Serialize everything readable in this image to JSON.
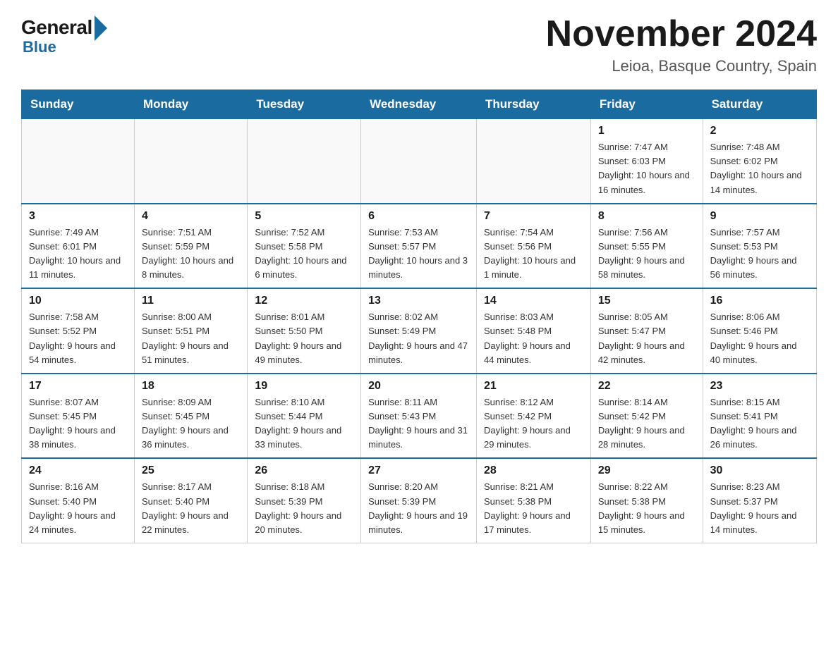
{
  "logo": {
    "general": "General",
    "blue": "Blue"
  },
  "title": "November 2024",
  "subtitle": "Leioa, Basque Country, Spain",
  "headers": [
    "Sunday",
    "Monday",
    "Tuesday",
    "Wednesday",
    "Thursday",
    "Friday",
    "Saturday"
  ],
  "weeks": [
    [
      {
        "day": "",
        "info": ""
      },
      {
        "day": "",
        "info": ""
      },
      {
        "day": "",
        "info": ""
      },
      {
        "day": "",
        "info": ""
      },
      {
        "day": "",
        "info": ""
      },
      {
        "day": "1",
        "info": "Sunrise: 7:47 AM\nSunset: 6:03 PM\nDaylight: 10 hours and 16 minutes."
      },
      {
        "day": "2",
        "info": "Sunrise: 7:48 AM\nSunset: 6:02 PM\nDaylight: 10 hours and 14 minutes."
      }
    ],
    [
      {
        "day": "3",
        "info": "Sunrise: 7:49 AM\nSunset: 6:01 PM\nDaylight: 10 hours and 11 minutes."
      },
      {
        "day": "4",
        "info": "Sunrise: 7:51 AM\nSunset: 5:59 PM\nDaylight: 10 hours and 8 minutes."
      },
      {
        "day": "5",
        "info": "Sunrise: 7:52 AM\nSunset: 5:58 PM\nDaylight: 10 hours and 6 minutes."
      },
      {
        "day": "6",
        "info": "Sunrise: 7:53 AM\nSunset: 5:57 PM\nDaylight: 10 hours and 3 minutes."
      },
      {
        "day": "7",
        "info": "Sunrise: 7:54 AM\nSunset: 5:56 PM\nDaylight: 10 hours and 1 minute."
      },
      {
        "day": "8",
        "info": "Sunrise: 7:56 AM\nSunset: 5:55 PM\nDaylight: 9 hours and 58 minutes."
      },
      {
        "day": "9",
        "info": "Sunrise: 7:57 AM\nSunset: 5:53 PM\nDaylight: 9 hours and 56 minutes."
      }
    ],
    [
      {
        "day": "10",
        "info": "Sunrise: 7:58 AM\nSunset: 5:52 PM\nDaylight: 9 hours and 54 minutes."
      },
      {
        "day": "11",
        "info": "Sunrise: 8:00 AM\nSunset: 5:51 PM\nDaylight: 9 hours and 51 minutes."
      },
      {
        "day": "12",
        "info": "Sunrise: 8:01 AM\nSunset: 5:50 PM\nDaylight: 9 hours and 49 minutes."
      },
      {
        "day": "13",
        "info": "Sunrise: 8:02 AM\nSunset: 5:49 PM\nDaylight: 9 hours and 47 minutes."
      },
      {
        "day": "14",
        "info": "Sunrise: 8:03 AM\nSunset: 5:48 PM\nDaylight: 9 hours and 44 minutes."
      },
      {
        "day": "15",
        "info": "Sunrise: 8:05 AM\nSunset: 5:47 PM\nDaylight: 9 hours and 42 minutes."
      },
      {
        "day": "16",
        "info": "Sunrise: 8:06 AM\nSunset: 5:46 PM\nDaylight: 9 hours and 40 minutes."
      }
    ],
    [
      {
        "day": "17",
        "info": "Sunrise: 8:07 AM\nSunset: 5:45 PM\nDaylight: 9 hours and 38 minutes."
      },
      {
        "day": "18",
        "info": "Sunrise: 8:09 AM\nSunset: 5:45 PM\nDaylight: 9 hours and 36 minutes."
      },
      {
        "day": "19",
        "info": "Sunrise: 8:10 AM\nSunset: 5:44 PM\nDaylight: 9 hours and 33 minutes."
      },
      {
        "day": "20",
        "info": "Sunrise: 8:11 AM\nSunset: 5:43 PM\nDaylight: 9 hours and 31 minutes."
      },
      {
        "day": "21",
        "info": "Sunrise: 8:12 AM\nSunset: 5:42 PM\nDaylight: 9 hours and 29 minutes."
      },
      {
        "day": "22",
        "info": "Sunrise: 8:14 AM\nSunset: 5:42 PM\nDaylight: 9 hours and 28 minutes."
      },
      {
        "day": "23",
        "info": "Sunrise: 8:15 AM\nSunset: 5:41 PM\nDaylight: 9 hours and 26 minutes."
      }
    ],
    [
      {
        "day": "24",
        "info": "Sunrise: 8:16 AM\nSunset: 5:40 PM\nDaylight: 9 hours and 24 minutes."
      },
      {
        "day": "25",
        "info": "Sunrise: 8:17 AM\nSunset: 5:40 PM\nDaylight: 9 hours and 22 minutes."
      },
      {
        "day": "26",
        "info": "Sunrise: 8:18 AM\nSunset: 5:39 PM\nDaylight: 9 hours and 20 minutes."
      },
      {
        "day": "27",
        "info": "Sunrise: 8:20 AM\nSunset: 5:39 PM\nDaylight: 9 hours and 19 minutes."
      },
      {
        "day": "28",
        "info": "Sunrise: 8:21 AM\nSunset: 5:38 PM\nDaylight: 9 hours and 17 minutes."
      },
      {
        "day": "29",
        "info": "Sunrise: 8:22 AM\nSunset: 5:38 PM\nDaylight: 9 hours and 15 minutes."
      },
      {
        "day": "30",
        "info": "Sunrise: 8:23 AM\nSunset: 5:37 PM\nDaylight: 9 hours and 14 minutes."
      }
    ]
  ],
  "colors": {
    "header_bg": "#1a6ba0",
    "border": "#1a6ba0"
  }
}
